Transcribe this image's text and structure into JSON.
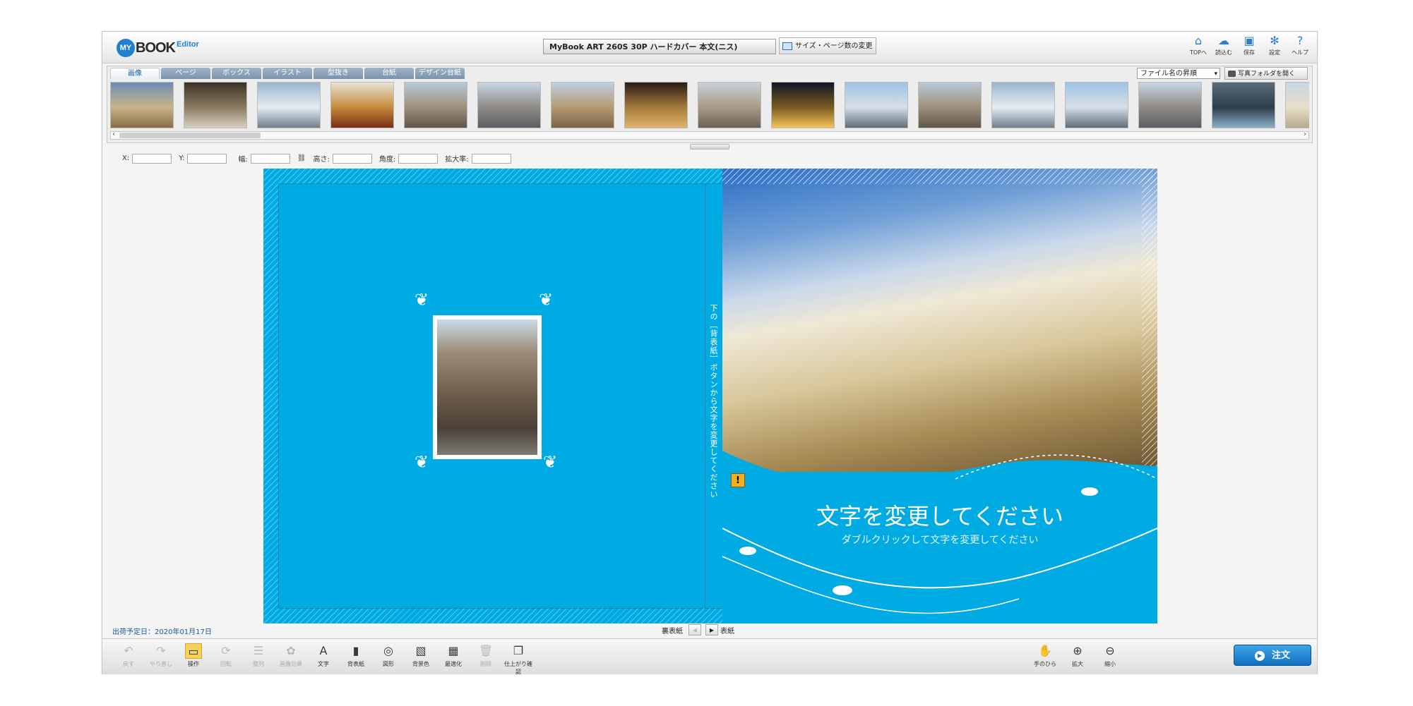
{
  "header": {
    "logo_circle": "MY",
    "logo_text": "BOOK",
    "logo_editor": "Editor",
    "product_title": "MyBook ART 260S 30P ハードカバー 本文(ニス)",
    "size_change_label": "サイズ・ページ数の変更",
    "nav": [
      {
        "icon": "home-icon",
        "glyph": "⌂",
        "label": "TOPへ"
      },
      {
        "icon": "load-icon",
        "glyph": "☁",
        "label": "読込む"
      },
      {
        "icon": "save-icon",
        "glyph": "▣",
        "label": "保存"
      },
      {
        "icon": "gear-icon",
        "glyph": "✻",
        "label": "設定"
      },
      {
        "icon": "help-icon",
        "glyph": "?",
        "label": "ヘルプ"
      }
    ]
  },
  "strip": {
    "tabs": [
      "画像",
      "ページ",
      "ボックス",
      "イラスト",
      "型抜き",
      "台紙",
      "デザイン台紙"
    ],
    "active_tab": 0,
    "sort_value": "ファイル名の昇順",
    "open_folder_label": "写真フォルダを開く",
    "thumb_count": 17
  },
  "props": {
    "x_label": "X:",
    "y_label": "Y:",
    "width_label": "幅:",
    "height_label": "高さ:",
    "angle_label": "角度:",
    "zoom_label": "拡大率:"
  },
  "canvas": {
    "spine_text": "下の［背表紙］ボタンから文字を変更してください",
    "title_text": "文字を変更してください",
    "subtitle_text": "ダブルクリックして文字を変更してください",
    "warning_glyph": "!",
    "colors": {
      "background": "#00abe4"
    }
  },
  "status": {
    "ship_date": "出荷予定日：2020年01月17日",
    "prev_label": "裏表紙",
    "next_label": "表紙"
  },
  "toolbar": {
    "tools": [
      {
        "name": "undo-icon",
        "glyph": "↶",
        "label": "戻す",
        "enabled": false
      },
      {
        "name": "redo-icon",
        "glyph": "↷",
        "label": "やり直し",
        "enabled": false
      },
      {
        "name": "operate-icon",
        "glyph": "▭",
        "label": "操作",
        "enabled": true,
        "active": true
      },
      {
        "name": "rotate-icon",
        "glyph": "⟳",
        "label": "回転",
        "enabled": false
      },
      {
        "name": "align-icon",
        "glyph": "☰",
        "label": "整列",
        "enabled": false
      },
      {
        "name": "image-effect-icon",
        "glyph": "✿",
        "label": "画像効果",
        "enabled": false
      },
      {
        "name": "text-icon",
        "glyph": "A",
        "label": "文字",
        "enabled": true
      },
      {
        "name": "spine-icon",
        "glyph": "▮",
        "label": "背表紙",
        "enabled": true
      },
      {
        "name": "shape-icon",
        "glyph": "◎",
        "label": "図形",
        "enabled": true
      },
      {
        "name": "bg-color-icon",
        "glyph": "▧",
        "label": "背景色",
        "enabled": true
      },
      {
        "name": "optimize-icon",
        "glyph": "▦",
        "label": "最適化",
        "enabled": true
      },
      {
        "name": "delete-icon",
        "glyph": "🗑",
        "label": "削除",
        "enabled": false
      },
      {
        "name": "preview-icon",
        "glyph": "❐",
        "label": "仕上がり確認",
        "enabled": true
      }
    ],
    "view_tools": [
      {
        "name": "hand-icon",
        "glyph": "✋",
        "label": "手のひら"
      },
      {
        "name": "zoom-in-icon",
        "glyph": "⊕",
        "label": "拡大"
      },
      {
        "name": "zoom-out-icon",
        "glyph": "⊖",
        "label": "縮小"
      }
    ],
    "order_label": "注文"
  }
}
